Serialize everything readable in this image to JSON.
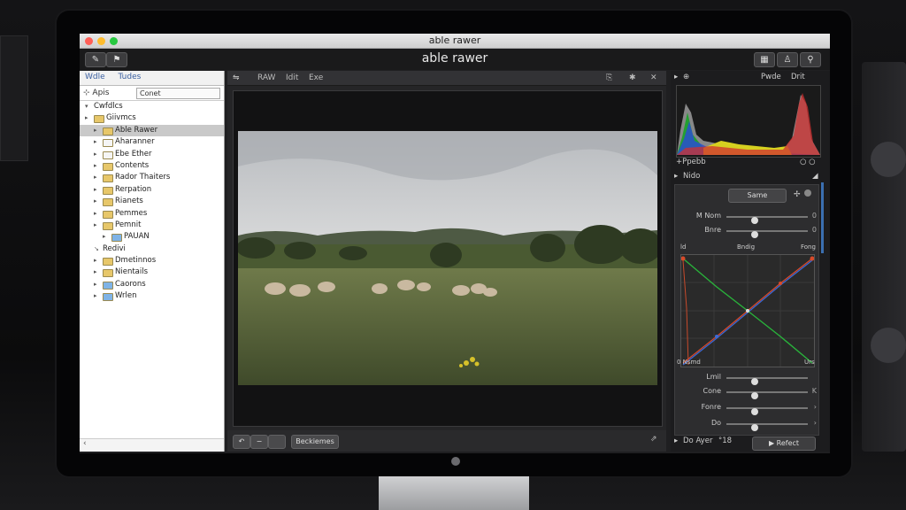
{
  "window": {
    "title": "able rawer",
    "app_title": "able rawer"
  },
  "traffic_lights": {
    "close": "#ff5f57",
    "minimize": "#febc2e",
    "zoom": "#28c840"
  },
  "toolbar": {
    "left_buttons": [
      "pencil-icon",
      "flag-icon"
    ],
    "right_buttons": [
      "grid-icon",
      "person-icon",
      "pin-icon"
    ]
  },
  "sidebar": {
    "tabs": [
      "Wdle",
      "Tudes"
    ],
    "search_label": "Apis",
    "search_value": "Conet",
    "items": [
      {
        "label": "Cwfdlcs",
        "arrow": "▾",
        "level": 0,
        "folder": false
      },
      {
        "label": "Giivmcs",
        "arrow": "▸",
        "level": 0,
        "folder": true,
        "color": "#e7c76a"
      },
      {
        "label": "Able Rawer",
        "arrow": "▸",
        "level": 1,
        "folder": true,
        "color": "#e7c76a",
        "selected": true
      },
      {
        "label": "Aharanner",
        "arrow": "▸",
        "level": 1,
        "folder": true,
        "color": "#f5f5f5"
      },
      {
        "label": "Ebe Ether",
        "arrow": "▸",
        "level": 1,
        "folder": true,
        "color": "#f5f5f5"
      },
      {
        "label": "Contents",
        "arrow": "▸",
        "level": 1,
        "folder": true,
        "color": "#e7c76a"
      },
      {
        "label": "Rador Thaiters",
        "arrow": "▸",
        "level": 1,
        "folder": true,
        "color": "#e7c76a"
      },
      {
        "label": "Rerpation",
        "arrow": "▸",
        "level": 1,
        "folder": true,
        "color": "#e7c76a"
      },
      {
        "label": "Rianets",
        "arrow": "▸",
        "level": 1,
        "folder": true,
        "color": "#e7c76a"
      },
      {
        "label": "Pemmes",
        "arrow": "▸",
        "level": 1,
        "folder": true,
        "color": "#e7c76a"
      },
      {
        "label": "Pemnit",
        "arrow": "▸",
        "level": 1,
        "folder": true,
        "color": "#e7c76a"
      },
      {
        "label": "PAUAN",
        "arrow": "▸",
        "level": 2,
        "folder": true,
        "color": "#7fb3e6"
      },
      {
        "label": "Redivi",
        "arrow": "↘",
        "level": 1,
        "folder": false
      },
      {
        "label": "Dmetinnos",
        "arrow": "▸",
        "level": 1,
        "folder": true,
        "color": "#e7c76a"
      },
      {
        "label": "Nientails",
        "arrow": "▸",
        "level": 1,
        "folder": true,
        "color": "#e7c76a"
      },
      {
        "label": "Caorons",
        "arrow": "▸",
        "level": 1,
        "folder": true,
        "color": "#7fb3e6"
      },
      {
        "label": "Wrlen",
        "arrow": "▸",
        "level": 1,
        "folder": true,
        "color": "#7fb3e6"
      }
    ],
    "footer_arrow": "‹"
  },
  "center": {
    "toolbar_items": [
      "RAW",
      "Idit",
      "Exe"
    ],
    "footer_button": "Beckiemes"
  },
  "right": {
    "histogram": {
      "header_left": "⊕",
      "header_tabs": [
        "Pwde",
        "Drit"
      ],
      "footer_left": "+Ppebb",
      "footer_right": "○ ○"
    },
    "section_title": "Nido",
    "preset_button": "Same",
    "sliders_top": [
      {
        "name": "M Nom",
        "value": "0",
        "pos": 0.35
      },
      {
        "name": "Bnre",
        "value": "0",
        "pos": 0.35
      }
    ],
    "curve_labels": {
      "top_left": "ld",
      "top_mid": "Bndig",
      "top_right": "Fong",
      "bottom_left": "0 Nsmd",
      "bottom_right": "Urs"
    },
    "sliders_bottom": [
      {
        "name": "Lmil",
        "value": "",
        "pos": 0.35
      },
      {
        "name": "Cone",
        "value": "K",
        "pos": 0.35
      },
      {
        "name": "Fonre",
        "value": "›",
        "pos": 0.35
      },
      {
        "name": "Do",
        "value": "›",
        "pos": 0.35
      }
    ],
    "footer_label": "Do Ayer",
    "footer_value": "°18",
    "footer_button": "Refect"
  },
  "scene": {
    "caption": ""
  }
}
